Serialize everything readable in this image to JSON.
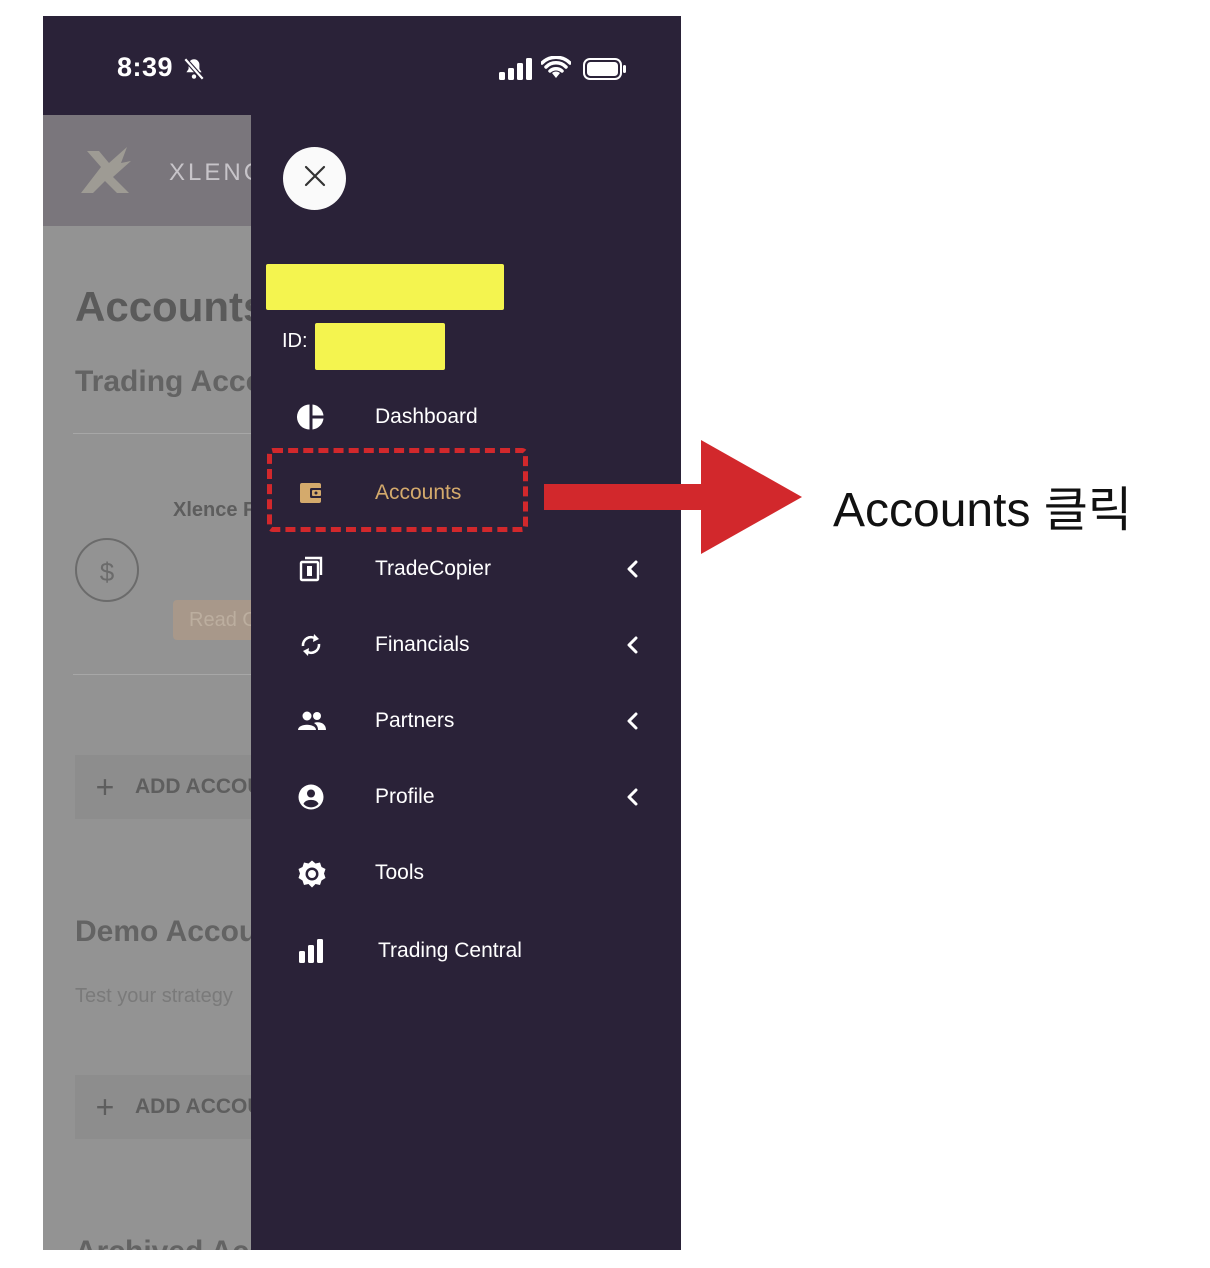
{
  "status_bar": {
    "time": "8:39"
  },
  "background_page": {
    "brand": "XLENCE",
    "title": "Accounts",
    "trading_section": "Trading Accounts",
    "account_name": "Xlence Fund",
    "account_currency_symbol": "$",
    "read_button": "Read Only",
    "add_account": "ADD ACCOUNT",
    "demo_section": "Demo Accounts",
    "demo_subtitle": "Test your strategy",
    "add_demo_account": "ADD ACCOUNT",
    "archived_section": "Archived Accounts"
  },
  "drawer": {
    "id_label": "ID:",
    "menu": [
      {
        "label": "Dashboard",
        "icon": "pie-chart-icon",
        "has_submenu": false
      },
      {
        "label": "Accounts",
        "icon": "wallet-icon",
        "has_submenu": false,
        "active": true
      },
      {
        "label": "TradeCopier",
        "icon": "copy-icon",
        "has_submenu": true
      },
      {
        "label": "Financials",
        "icon": "sync-icon",
        "has_submenu": true
      },
      {
        "label": "Partners",
        "icon": "people-icon",
        "has_submenu": true
      },
      {
        "label": "Profile",
        "icon": "account-circle-icon",
        "has_submenu": true
      },
      {
        "label": "Tools",
        "icon": "gear-icon",
        "has_submenu": false
      },
      {
        "label": "Trading Central",
        "icon": "bar-chart-icon",
        "has_submenu": false
      }
    ]
  },
  "annotation": {
    "callout": "Accounts 클릭"
  },
  "colors": {
    "drawer_bg": "#2a2238",
    "active_text": "#d4aa6c",
    "redaction": "#f4f44f",
    "highlight_red": "#d2282c"
  }
}
